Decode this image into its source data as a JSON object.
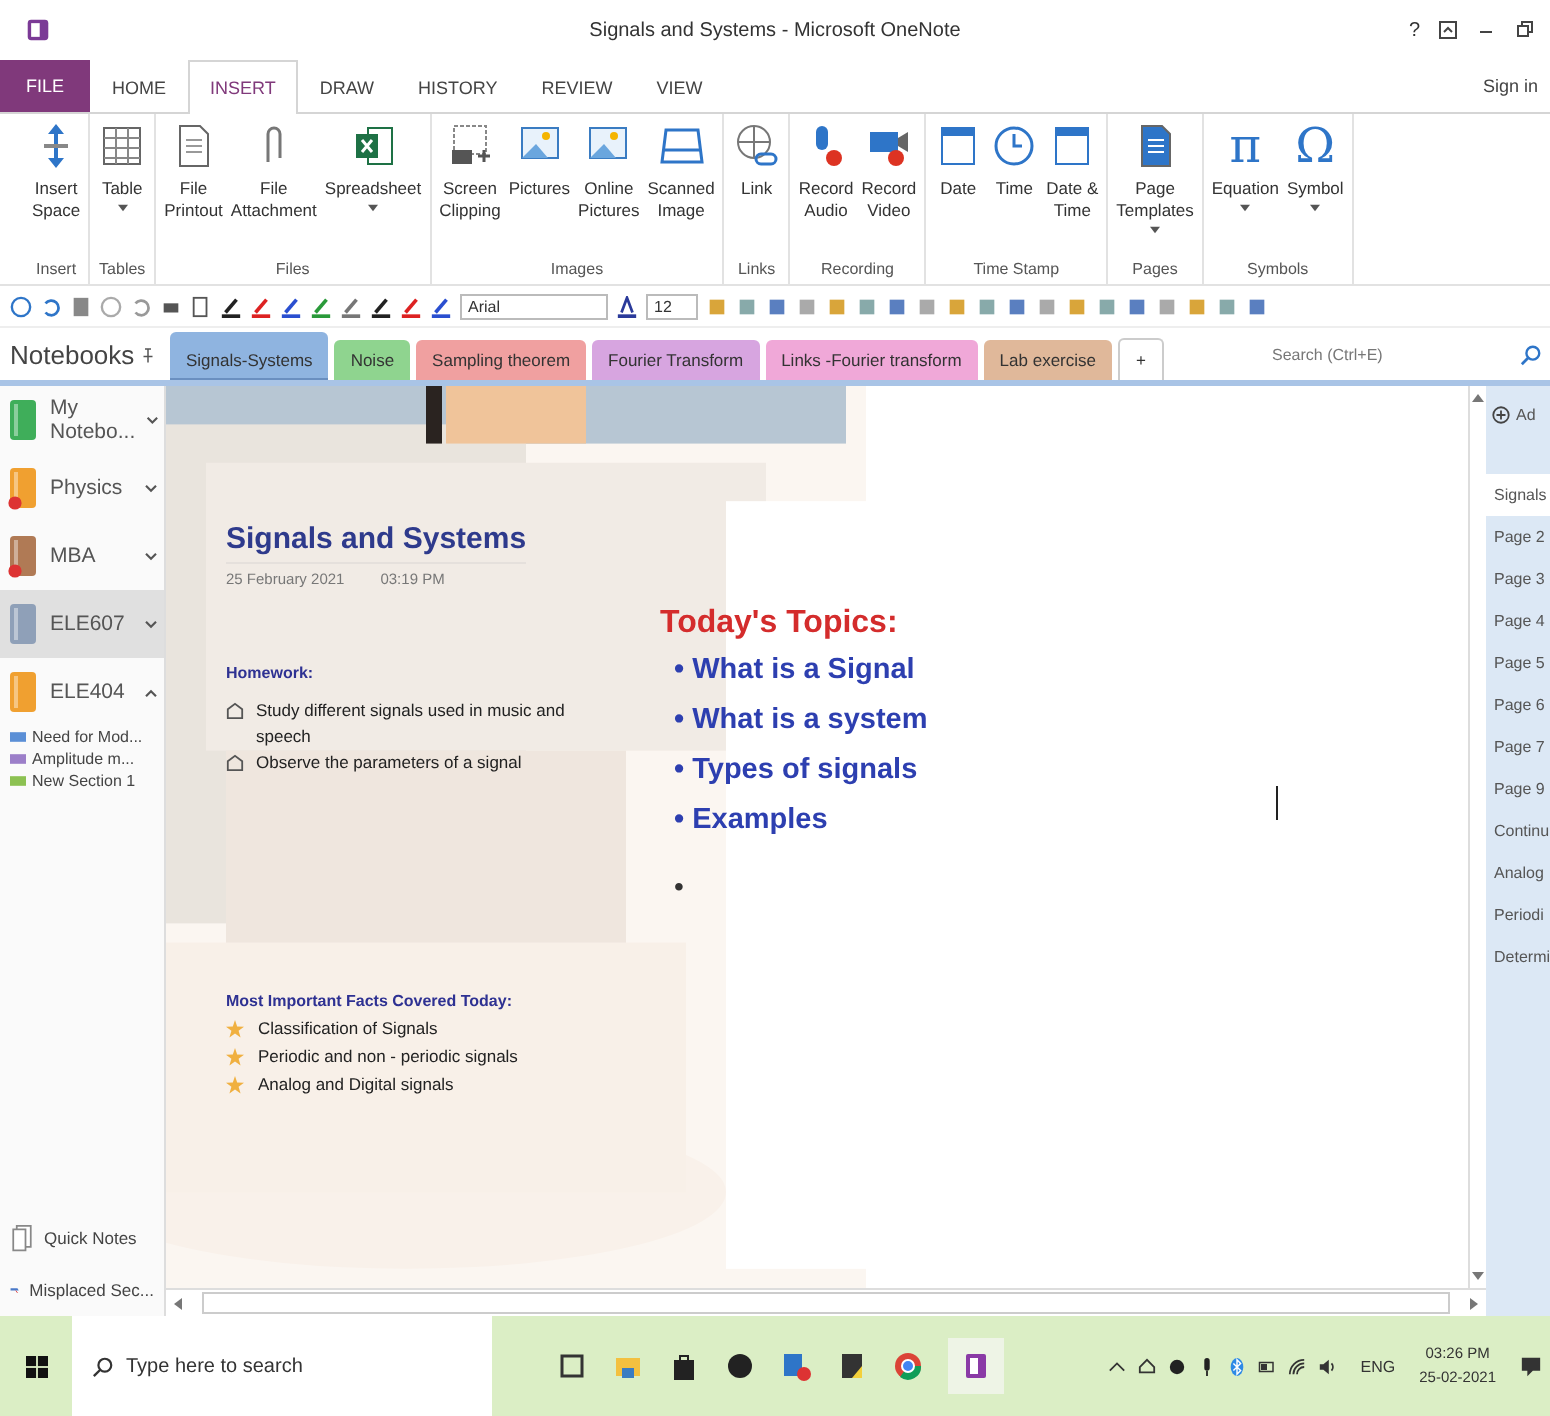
{
  "window": {
    "title": "Signals and Systems - Microsoft OneNote",
    "help": "?"
  },
  "ribbon_tabs": [
    {
      "label": "FILE",
      "kind": "file",
      "selected": false
    },
    {
      "label": "HOME",
      "kind": "tab",
      "selected": false
    },
    {
      "label": "INSERT",
      "kind": "tab",
      "selected": true
    },
    {
      "label": "DRAW",
      "kind": "tab",
      "selected": false
    },
    {
      "label": "HISTORY",
      "kind": "tab",
      "selected": false
    },
    {
      "label": "REVIEW",
      "kind": "tab",
      "selected": false
    },
    {
      "label": "VIEW",
      "kind": "tab",
      "selected": false
    }
  ],
  "sign_in": "Sign in",
  "ribbon_groups": [
    {
      "label": "Insert",
      "buttons": [
        {
          "label": "Insert\nSpace",
          "dropdown": false
        }
      ]
    },
    {
      "label": "Tables",
      "buttons": [
        {
          "label": "Table",
          "dropdown": true
        }
      ]
    },
    {
      "label": "Files",
      "buttons": [
        {
          "label": "File\nPrintout",
          "dropdown": false
        },
        {
          "label": "File\nAttachment",
          "dropdown": false
        },
        {
          "label": "Spreadsheet",
          "dropdown": true
        }
      ]
    },
    {
      "label": "Images",
      "buttons": [
        {
          "label": "Screen\nClipping",
          "dropdown": false
        },
        {
          "label": "Pictures",
          "dropdown": false
        },
        {
          "label": "Online\nPictures",
          "dropdown": false
        },
        {
          "label": "Scanned\nImage",
          "dropdown": false
        }
      ]
    },
    {
      "label": "Links",
      "buttons": [
        {
          "label": "Link",
          "dropdown": false
        }
      ]
    },
    {
      "label": "Recording",
      "buttons": [
        {
          "label": "Record\nAudio",
          "dropdown": false
        },
        {
          "label": "Record\nVideo",
          "dropdown": false
        }
      ]
    },
    {
      "label": "Time Stamp",
      "buttons": [
        {
          "label": "Date",
          "dropdown": false
        },
        {
          "label": "Time",
          "dropdown": false
        },
        {
          "label": "Date &\nTime",
          "dropdown": false
        }
      ]
    },
    {
      "label": "Pages",
      "buttons": [
        {
          "label": "Page\nTemplates",
          "dropdown": true
        }
      ]
    },
    {
      "label": "Symbols",
      "buttons": [
        {
          "label": "Equation",
          "glyph": "π",
          "dropdown": true
        },
        {
          "label": "Symbol",
          "glyph": "Ω",
          "dropdown": true
        }
      ]
    }
  ],
  "format_bar": {
    "font": "Arial",
    "size": "12"
  },
  "notebooks_header": "Notebooks",
  "notebooks": [
    {
      "name": "My\nNotebo...",
      "color": "#3fae5a",
      "expanded": false,
      "selected": false,
      "error": false
    },
    {
      "name": "Physics",
      "color": "#f0a030",
      "expanded": false,
      "selected": false,
      "error": true
    },
    {
      "name": "MBA",
      "color": "#b07a55",
      "expanded": false,
      "selected": false,
      "error": true
    },
    {
      "name": "ELE607",
      "color": "#8fa0b8",
      "expanded": false,
      "selected": true,
      "error": false
    },
    {
      "name": "ELE404",
      "color": "#f0a030",
      "expanded": true,
      "selected": false,
      "error": false,
      "sections": [
        {
          "name": "Need for Mod...",
          "color": "#5b8fd6"
        },
        {
          "name": "Amplitude m...",
          "color": "#9c7fc9"
        },
        {
          "name": "New Section 1",
          "color": "#8cc152"
        }
      ]
    }
  ],
  "quick_notes": "Quick Notes",
  "misplaced_sections": "Misplaced Sec...",
  "section_tabs": [
    {
      "label": "Signals-Systems",
      "color": "#8fb4e0",
      "selected": true
    },
    {
      "label": "Noise",
      "color": "#8fd48f",
      "selected": false
    },
    {
      "label": "Sampling theorem",
      "color": "#f0a0a0",
      "selected": false
    },
    {
      "label": "Fourier Transform",
      "color": "#d7a5e0",
      "selected": false
    },
    {
      "label": "Links -Fourier transform",
      "color": "#f0a8d8",
      "selected": false
    },
    {
      "label": "Lab exercise",
      "color": "#e0b89a",
      "selected": false
    }
  ],
  "add_tab": "+",
  "search": {
    "placeholder": "Search (Ctrl+E)"
  },
  "add_page": "Ad",
  "page": {
    "title": "Signals and Systems",
    "date": "25 February 2021",
    "time": "03:19 PM",
    "homework_heading": "Homework:",
    "homework": [
      {
        "text": "Study different signals used in music and speech",
        "checked": false
      },
      {
        "text": "Observe the parameters of a signal",
        "checked": false
      }
    ],
    "topics_heading": "Today's Topics:",
    "topic_bullet": "•",
    "topics": [
      "What is a Signal",
      "What is a system",
      "Types of signals",
      "Examples"
    ],
    "empty_bullet": "•",
    "facts_heading": "Most Important Facts Covered Today:",
    "facts": [
      "Classification of Signals",
      "Periodic and non - periodic signals",
      "Analog and Digital signals"
    ]
  },
  "pages": [
    {
      "label": "Signals",
      "selected": true
    },
    {
      "label": "Page 2",
      "selected": false
    },
    {
      "label": "Page 3",
      "selected": false
    },
    {
      "label": "Page 4",
      "selected": false
    },
    {
      "label": "Page 5",
      "selected": false
    },
    {
      "label": "Page 6",
      "selected": false
    },
    {
      "label": "Page 7",
      "selected": false
    },
    {
      "label": "Page 9",
      "selected": false
    },
    {
      "label": "Continu",
      "selected": false
    },
    {
      "label": "Analog",
      "selected": false
    },
    {
      "label": "Periodi",
      "selected": false
    },
    {
      "label": "Determi",
      "selected": false
    }
  ],
  "taskbar": {
    "search_placeholder": "Type here to search",
    "language": "ENG",
    "time": "03:26 PM",
    "date": "25-02-2021"
  }
}
